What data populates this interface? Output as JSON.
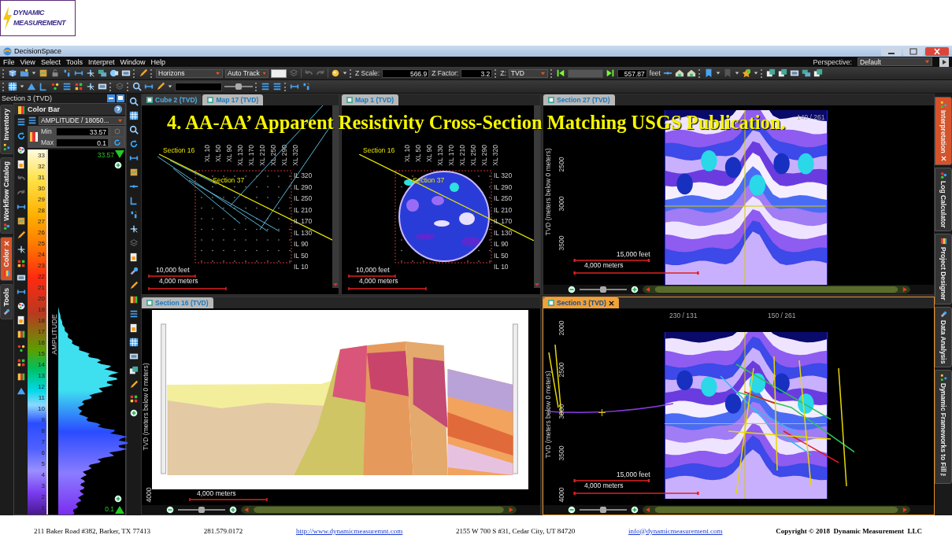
{
  "slide": {
    "logo": {
      "line_1": "DYNAMIC",
      "line_2": "MEASUREMENT"
    },
    "caption": "4. AA-AA’ Apparent Resistivity Cross-Section Matching USGS Publication."
  },
  "window": {
    "title": "DecisionSpace"
  },
  "menu": [
    "File",
    "View",
    "Select",
    "Tools",
    "Interpret",
    "Window",
    "Help"
  ],
  "perspective": {
    "label": "Perspective:",
    "value": "Default"
  },
  "toolbar": {
    "horizon_type": "Horizons",
    "track_mode": "Auto Track",
    "z_scale_label": "Z Scale:",
    "z_scale": "566.9",
    "z_factor_label": "Z Factor:",
    "z_factor": "3.2",
    "z_label": "Z:",
    "z_domain": "TVD",
    "step": "557.87",
    "step_unit": "feet",
    "slider": {
      "level": 0.5
    }
  },
  "left_panel": {
    "title": "Section 3 (TVD)",
    "side_tabs": [
      {
        "label": "Inventory",
        "selected": false,
        "closable": false
      },
      {
        "label": "Workflow Catalog",
        "selected": false,
        "closable": false
      },
      {
        "label": "Color",
        "selected": true,
        "closable": true
      },
      {
        "label": "Tools",
        "selected": false,
        "closable": false
      }
    ],
    "color_bar": {
      "title": "Color Bar",
      "attribute": "AMPLITUDE / 18050...",
      "min_label": "Min",
      "min": "33.57",
      "max_label": "Max",
      "max": "0.1",
      "axis_label": "AMPLITUDE",
      "top_value": "33.57",
      "bottom_value": "0.1",
      "ticks": [
        "33",
        "32",
        "31",
        "30",
        "29",
        "28",
        "27",
        "26",
        "25",
        "24",
        "23",
        "22",
        "21",
        "20",
        "19",
        "18",
        "17",
        "16",
        "15",
        "14",
        "13",
        "12",
        "11",
        "10",
        "9",
        "8",
        "7",
        "6",
        "5",
        "4",
        "3",
        "2",
        "1"
      ]
    }
  },
  "views": [
    {
      "kind": "map",
      "active": false,
      "tabs": [
        {
          "label": "Cube 2 (TVD)",
          "selected": false,
          "closable": false
        },
        {
          "label": "Map 17 (TVD)",
          "selected": true,
          "closable": false
        }
      ],
      "crosslines": [
        "XL 10",
        "XL 50",
        "XL 90",
        "XL 130",
        "XL 170",
        "XL 210",
        "XL 250",
        "XL 290",
        "XL 320"
      ],
      "inlines": [
        "IL 320",
        "IL 290",
        "IL 250",
        "IL 210",
        "IL 170",
        "IL 130",
        "IL 90",
        "IL 50",
        "IL 10"
      ],
      "sections": [
        "Section 16",
        "Section 37"
      ],
      "scale": [
        "10,000 feet",
        "4,000 meters"
      ]
    },
    {
      "kind": "heatmap",
      "active": false,
      "tabs": [
        {
          "label": "Map 1 (TVD)",
          "selected": true,
          "closable": false
        }
      ],
      "crosslines": [
        "XL 10",
        "XL 50",
        "XL 90",
        "XL 130",
        "XL 170",
        "XL 210",
        "XL 250",
        "XL 290",
        "XL 320"
      ],
      "inlines": [
        "IL 320",
        "IL 290",
        "IL 250",
        "IL 210",
        "IL 170",
        "IL 130",
        "IL 90",
        "IL 50",
        "IL 10"
      ],
      "sections": [
        "Section 16",
        "Section 37"
      ],
      "scale": [
        "10,000 feet",
        "4,000 meters"
      ]
    },
    {
      "kind": "section",
      "active": false,
      "tabs": [
        {
          "label": "Section 27 (TVD)",
          "selected": true,
          "closable": false
        }
      ],
      "positions": [
        "149 / 261"
      ],
      "depth_label": "TVD (meters below 0 meters)",
      "depth_ticks": [
        "2500",
        "3000",
        "3500"
      ],
      "scale": [
        "15,000 feet",
        "4,000 meters"
      ],
      "zoom": {
        "level": 0.5
      }
    },
    {
      "active": false,
      "tabs": [
        {
          "label": "Section 16 (TVD)",
          "selected": true,
          "closable": false
        }
      ],
      "depth_label": "TVD (meters below 0 meters)",
      "depth_ticks": [
        "4000"
      ],
      "scale": [
        "4,000 meters"
      ],
      "zoom": {
        "level": 0.5
      }
    },
    {
      "kind": "horizons",
      "active": true,
      "tabs": [
        {
          "label": "Section 3 (TVD)",
          "selected": true,
          "closable": true
        }
      ],
      "positions": [
        "230 / 131",
        "150 / 261"
      ],
      "depth_label": "TVD (meters below 0 meters)",
      "depth_ticks": [
        "2000",
        "2500",
        "3000",
        "3500",
        "4000"
      ],
      "scale": [
        "15,000 feet",
        "4,000 meters"
      ],
      "zoom": {
        "level": 0.5
      }
    }
  ],
  "right_tabs": [
    {
      "label": "Interpretation",
      "selected": true,
      "closable": true
    },
    {
      "label": "Log Calculator",
      "selected": false,
      "closable": false
    },
    {
      "label": "Project Designer",
      "selected": false,
      "closable": false
    },
    {
      "label": "Data Analysis",
      "selected": false,
      "closable": false
    },
    {
      "label": "Dynamic Frameworks to Fill™",
      "selected": false,
      "closable": false
    }
  ],
  "footer": [
    {
      "kind": "text",
      "text": "211 Baker Road #382, Barker, TX 77413"
    },
    {
      "kind": "text",
      "text": "281.579.0172"
    },
    {
      "kind": "link",
      "text": "http://www.dynamicmeasuremnt.com"
    },
    {
      "kind": "text",
      "text": "2155 W 700 S #31, Cedar City, UT 84720"
    },
    {
      "kind": "link",
      "text": "info@dynamicmeasurement.com"
    },
    {
      "kind": "bold",
      "text": "Copyright © 2018  Dynamic Measurement  LLC"
    }
  ]
}
